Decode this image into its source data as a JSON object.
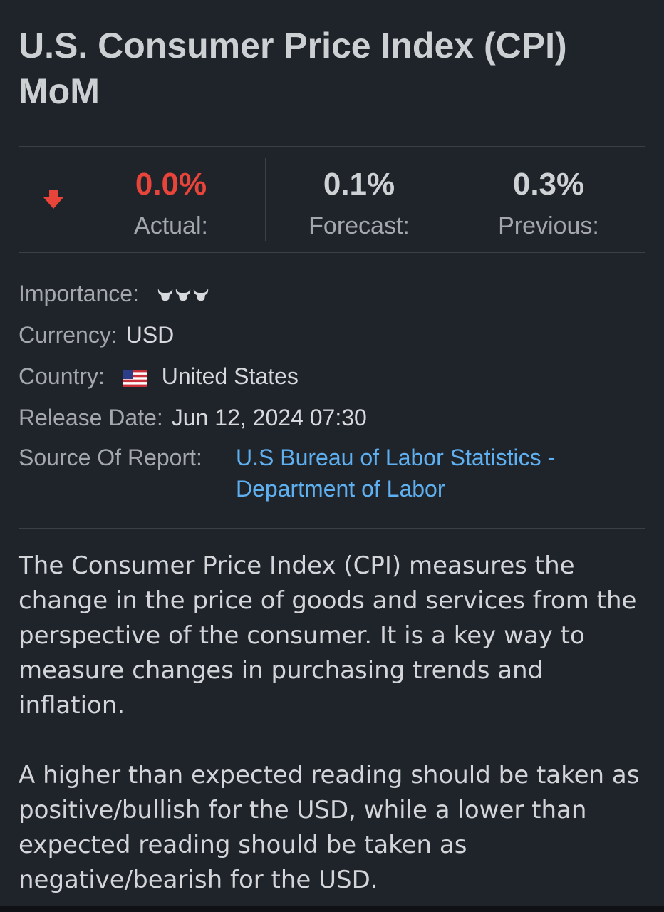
{
  "title": "U.S. Consumer Price Index (CPI) MoM",
  "stats": {
    "direction_icon": "arrow-down-icon",
    "actual": {
      "value": "0.0%",
      "label": "Actual:",
      "color": "#e8443a"
    },
    "forecast": {
      "value": "0.1%",
      "label": "Forecast:"
    },
    "previous": {
      "value": "0.3%",
      "label": "Previous:"
    }
  },
  "details": {
    "importance": {
      "label": "Importance:",
      "level": 3,
      "icon": "bull-icon"
    },
    "currency": {
      "label": "Currency:",
      "value": "USD"
    },
    "country": {
      "label": "Country:",
      "value": "United States",
      "flag_icon": "us-flag-icon"
    },
    "release_date": {
      "label": "Release Date:",
      "value": "Jun 12, 2024 07:30"
    },
    "source": {
      "label": "Source Of Report:",
      "value": "U.S Bureau of Labor Statistics - Department of Labor",
      "color": "#5fb0f0"
    }
  },
  "description": [
    "The Consumer Price Index (CPI) measures the change in the price of goods and services from the perspective of the consumer. It is a key way to measure changes in purchasing trends and inflation.",
    "A higher than expected reading should be taken as positive/bullish for the USD, while a lower than expected reading should be taken as negative/bearish for the USD."
  ]
}
